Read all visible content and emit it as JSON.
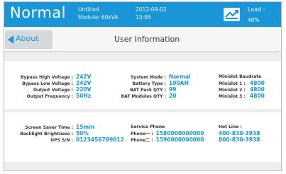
{
  "header": {
    "mode": "Normal",
    "device_name": "Untitled",
    "device_model": "Modular 60kVA",
    "date": "2012-09-02",
    "time": "13:05",
    "load_label": "Load :",
    "load_value": "40%"
  },
  "titlebar": {
    "back_label": "About",
    "title": "User Information"
  },
  "info": {
    "bypass_high_voltage": {
      "label": "Bypass High Voltage :",
      "value": "242V"
    },
    "bypass_low_voltage": {
      "label": "Bypass Low Voltage :",
      "value": "242V"
    },
    "output_voltage": {
      "label": "Output Voltage :",
      "value": "220V"
    },
    "output_frequency": {
      "label": "Output Frequency :",
      "value": "50Hz"
    },
    "system_mode": {
      "label": "System Mode :",
      "value": "Normal"
    },
    "battery_type": {
      "label": "Battery Type :",
      "value": "100AH"
    },
    "bat_pack_qty": {
      "label": "BAT Pack QTY :",
      "value": "99"
    },
    "bat_modules_qty": {
      "label": "BAT Modules QTY :",
      "value": "20"
    },
    "minislot_baudrate": {
      "label": "Minislot Baudrate"
    },
    "minislot1": {
      "label": "Minislot 1 :",
      "value": "4800"
    },
    "minislot2": {
      "label": "Minislot 2 :",
      "value": "4800"
    },
    "minislot3": {
      "label": "Minislot 3 :",
      "value": "4800"
    }
  },
  "contact": {
    "screen_saver_time": {
      "label": "Screen Saver Time :",
      "value": "15min"
    },
    "backlight_brightness": {
      "label": "Backlight Brightness :",
      "value": "50%"
    },
    "ups_sn": {
      "label": "UPS S/N :",
      "value": "0123456789012"
    },
    "service_phone": {
      "label": "Service Phone"
    },
    "phone1": {
      "label": "Phone一 :",
      "value": "1580000000000"
    },
    "phone2": {
      "label": "Phone二 :",
      "value": "1590000000000"
    },
    "hot_line": {
      "label": "Hot Line :",
      "values": [
        "400-830-3938",
        "800-830-3938"
      ]
    }
  },
  "colors": {
    "accent": "#1a96d8",
    "panel_bg": "#ffffff",
    "screen_bg": "#eeeeee"
  },
  "icons": {
    "screen_icon": "monitor-signal-icon"
  }
}
